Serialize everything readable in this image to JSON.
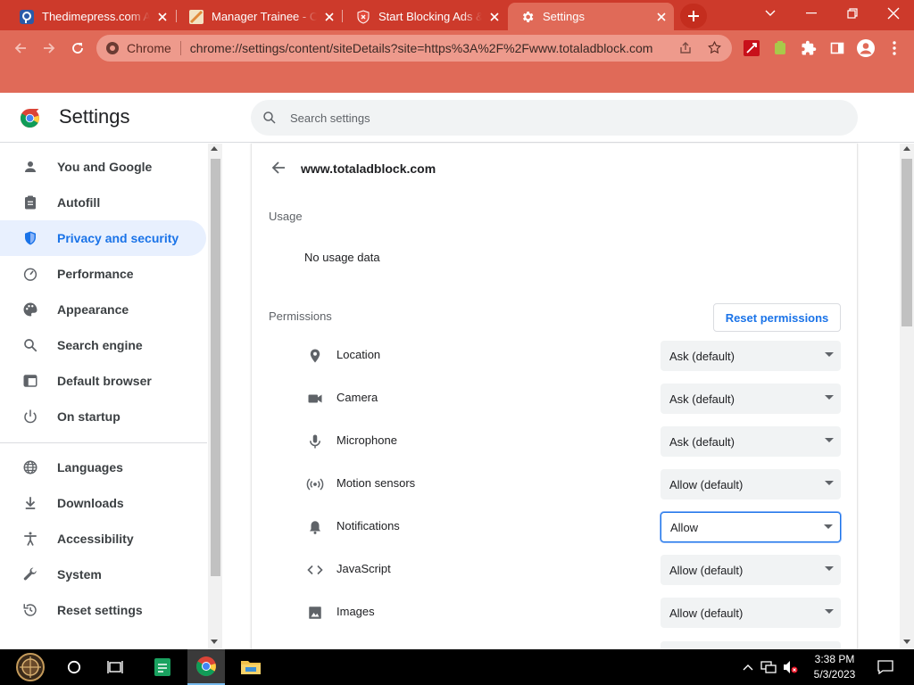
{
  "browser": {
    "tabs": [
      {
        "title": "Thedimepress.com Ad",
        "favicon": "thedimepress-favicon",
        "active": false
      },
      {
        "title": "Manager Trainee - Op",
        "favicon": "manager-favicon",
        "active": false
      },
      {
        "title": "Start Blocking Ads &",
        "favicon": "shield-favicon",
        "active": false
      },
      {
        "title": "Settings",
        "favicon": "gear-icon",
        "active": true
      }
    ],
    "omnibox": {
      "site_label": "Chrome",
      "url": "chrome://settings/content/siteDetails?site=https%3A%2F%2Fwww.totaladblock.com"
    },
    "colors": {
      "tabstrip": "#cd3a2b",
      "toolbar": "#e06a58"
    }
  },
  "settings": {
    "title": "Settings",
    "search_placeholder": "Search settings",
    "nav": [
      {
        "label": "You and Google",
        "icon": "person-icon",
        "active": false
      },
      {
        "label": "Autofill",
        "icon": "clipboard-icon",
        "active": false
      },
      {
        "label": "Privacy and security",
        "icon": "shield-icon",
        "active": true
      },
      {
        "label": "Performance",
        "icon": "speedometer-icon",
        "active": false
      },
      {
        "label": "Appearance",
        "icon": "palette-icon",
        "active": false
      },
      {
        "label": "Search engine",
        "icon": "search-icon",
        "active": false
      },
      {
        "label": "Default browser",
        "icon": "browser-icon",
        "active": false
      },
      {
        "label": "On startup",
        "icon": "power-icon",
        "active": false
      },
      {
        "label": "Languages",
        "icon": "globe-icon",
        "active": false
      },
      {
        "label": "Downloads",
        "icon": "download-icon",
        "active": false
      },
      {
        "label": "Accessibility",
        "icon": "accessibility-icon",
        "active": false
      },
      {
        "label": "System",
        "icon": "wrench-icon",
        "active": false
      },
      {
        "label": "Reset settings",
        "icon": "history-icon",
        "active": false
      }
    ],
    "site": "www.totaladblock.com",
    "usage": {
      "heading": "Usage",
      "text": "No usage data"
    },
    "permissions": {
      "heading": "Permissions",
      "reset_label": "Reset permissions",
      "items": [
        {
          "name": "Location",
          "value": "Ask (default)",
          "icon": "location-pin-icon"
        },
        {
          "name": "Camera",
          "value": "Ask (default)",
          "icon": "camera-icon"
        },
        {
          "name": "Microphone",
          "value": "Ask (default)",
          "icon": "microphone-icon"
        },
        {
          "name": "Motion sensors",
          "value": "Allow (default)",
          "icon": "sensors-icon"
        },
        {
          "name": "Notifications",
          "value": "Allow",
          "icon": "bell-icon"
        },
        {
          "name": "JavaScript",
          "value": "Allow (default)",
          "icon": "code-icon"
        },
        {
          "name": "Images",
          "value": "Allow (default)",
          "icon": "image-icon"
        }
      ]
    }
  },
  "taskbar": {
    "time": "3:38 PM",
    "date": "5/3/2023"
  }
}
